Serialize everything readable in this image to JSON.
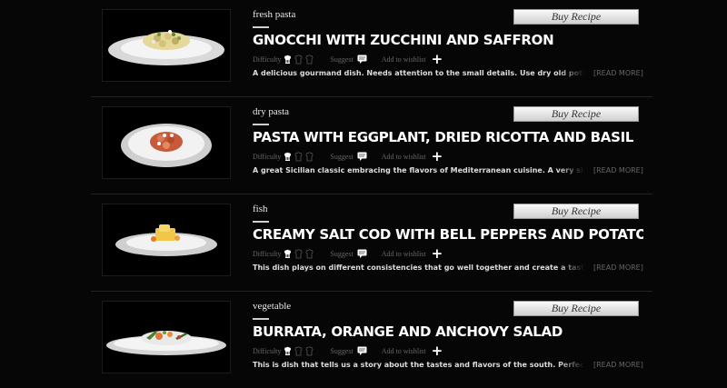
{
  "recipes": [
    {
      "category": "fresh pasta",
      "title": "GNOCCHI WITH ZUCCHINI AND SAFFRON",
      "buy_label": "Buy Recipe",
      "difficulty_label": "Difficulty",
      "suggest_label": "Suggest",
      "wishlist_label": "Add to wishlist",
      "plus": "+",
      "description": "A delicious gourmand dish. Needs attention to the small details. Use dry old potatoes, saffron, zucchini and thyme.",
      "read_more": "[READ MORE]",
      "difficulty_active": 1
    },
    {
      "category": "dry pasta",
      "title": "PASTA WITH EGGPLANT, DRIED RICOTTA AND BASIL",
      "buy_label": "Buy Recipe",
      "difficulty_label": "Difficulty",
      "suggest_label": "Suggest",
      "wishlist_label": "Add to wishlist",
      "plus": "+",
      "description": "A great Sicilian classic embracing the flavors of Mediterranean cuisine. A very simple dish. Best made when the eggplants are in season.",
      "read_more": "[READ MORE]",
      "difficulty_active": 1
    },
    {
      "category": "fish",
      "title": "CREAMY SALT COD WITH BELL PEPPERS AND POTATOES",
      "buy_label": "Buy Recipe",
      "difficulty_label": "Difficulty",
      "suggest_label": "Suggest",
      "wishlist_label": "Add to wishlist",
      "plus": "+",
      "description": "This dish plays on different consistencies that go well together and create a tasteful harmony. To be served as a main course.",
      "read_more": "[READ MORE]",
      "difficulty_active": 1
    },
    {
      "category": "vegetable",
      "title": "BURRATA, ORANGE AND ANCHOVY SALAD",
      "buy_label": "Buy Recipe",
      "difficulty_label": "Difficulty",
      "suggest_label": "Suggest",
      "wishlist_label": "Add to wishlist",
      "plus": "+",
      "description": "This is dish that tells us a story about the tastes and flavors of the south. Perfect for a light and quick antipasto.",
      "read_more": "[READ MORE]",
      "difficulty_active": 1
    }
  ],
  "icons": {
    "difficulty": "chef-hat-icon",
    "suggest": "speech-bubble-icon",
    "wishlist": "plus-icon"
  }
}
